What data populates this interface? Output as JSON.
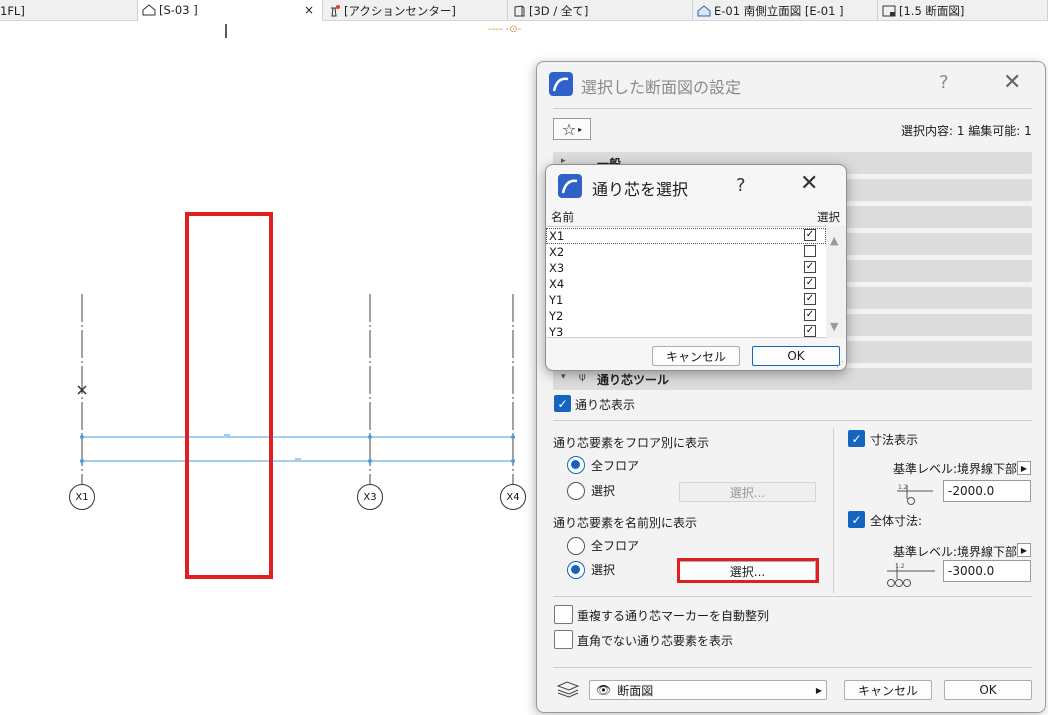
{
  "tabs": [
    {
      "label": "1FL]",
      "icon": "floor-plan-icon",
      "close": ""
    },
    {
      "label": "[S-03 ]",
      "icon": "section-icon",
      "close": "×"
    },
    {
      "label": "[アクションセンター]",
      "icon": "lighthouse-icon",
      "close": ""
    },
    {
      "label": "[3D / 全て]",
      "icon": "3d-icon",
      "close": ""
    },
    {
      "label": "E-01 南側立面図 [E-01 ]",
      "icon": "elevation-icon",
      "close": ""
    },
    {
      "label": "[1.5 断面図]",
      "icon": "layout-icon",
      "close": ""
    }
  ],
  "canvas": {
    "bubbles": [
      "X1",
      "X3",
      "X4"
    ],
    "marker_text": "----  -⊙-"
  },
  "main_dialog": {
    "title": "選択した断面図の設定",
    "help": "?",
    "close": "✕",
    "favorites_icon": "☆",
    "selection_info": "選択内容: 1 編集可能: 1",
    "panels": [
      {
        "label": "一般",
        "arrow": "▸"
      },
      {
        "label": "",
        "arrow": ""
      },
      {
        "label": "",
        "arrow": ""
      },
      {
        "label": "",
        "arrow": ""
      },
      {
        "label": "",
        "arrow": ""
      },
      {
        "label": "",
        "arrow": ""
      },
      {
        "label": "",
        "arrow": ""
      },
      {
        "label": "",
        "arrow": ""
      },
      {
        "label": "通り芯ツール",
        "arrow": "▾"
      }
    ],
    "grid_display_label": "通り芯表示",
    "by_floor": {
      "heading": "通り芯要素をフロア別に表示",
      "all_label": "全フロア",
      "select_label": "選択",
      "select_button": "選択..."
    },
    "by_name": {
      "heading": "通り芯要素を名前別に表示",
      "all_label": "全フロア",
      "select_label": "選択",
      "select_button": "選択..."
    },
    "dimension": {
      "label": "寸法表示",
      "ref_level": "基準レベル:境界線下部",
      "value": "-2000.0"
    },
    "overall_dimension": {
      "label": "全体寸法:",
      "ref_level": "基準レベル:境界線下部",
      "value": "-3000.0"
    },
    "auto_arrange_label": "重複する通り芯マーカーを自動整列",
    "non_orthogonal_label": "直角でない通り芯要素を表示",
    "footer": {
      "view_label": "断面図",
      "cancel": "キャンセル",
      "ok": "OK"
    }
  },
  "popup": {
    "title": "通り芯を選択",
    "help": "?",
    "close": "✕",
    "col_name": "名前",
    "col_select": "選択",
    "rows": [
      {
        "name": "X1",
        "checked": "✓"
      },
      {
        "name": "X2",
        "checked": ""
      },
      {
        "name": "X3",
        "checked": "✓"
      },
      {
        "name": "X4",
        "checked": "✓"
      },
      {
        "name": "Y1",
        "checked": "✓"
      },
      {
        "name": "Y2",
        "checked": "✓"
      },
      {
        "name": "Y3",
        "checked": "✓"
      }
    ],
    "cancel": "キャンセル",
    "ok": "OK"
  },
  "colors": {
    "accent": "#1565c0",
    "highlight": "#e02020",
    "gridline": "#4a9ee0"
  }
}
